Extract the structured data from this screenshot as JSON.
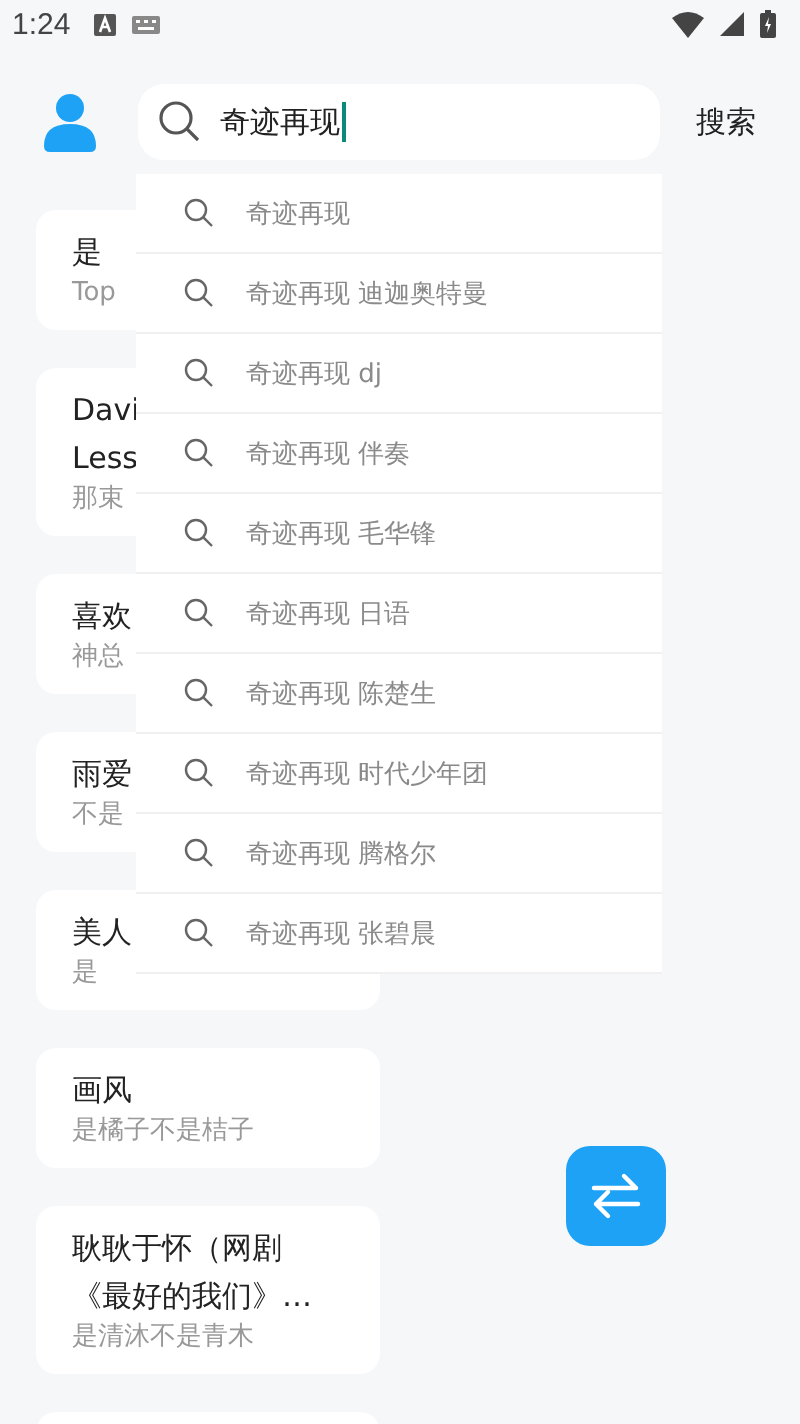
{
  "status_bar": {
    "time": "1:24"
  },
  "search": {
    "value": "奇迹再现",
    "button": "搜索"
  },
  "suggestions": [
    {
      "text": "奇迹再现"
    },
    {
      "text": "奇迹再现 迪迦奥特曼"
    },
    {
      "text": "奇迹再现 dj"
    },
    {
      "text": "奇迹再现 伴奏"
    },
    {
      "text": "奇迹再现 毛华锋"
    },
    {
      "text": "奇迹再现 日语"
    },
    {
      "text": "奇迹再现 陈楚生"
    },
    {
      "text": "奇迹再现 时代少年团"
    },
    {
      "text": "奇迹再现 腾格尔"
    },
    {
      "text": "奇迹再现 张碧晨"
    }
  ],
  "songs": [
    {
      "title": [
        "是"
      ],
      "artist": "Top"
    },
    {
      "title": [
        "Davi",
        "Less"
      ],
      "artist": "那束"
    },
    {
      "title": [
        "喜欢"
      ],
      "artist": "神总"
    },
    {
      "title": [
        "雨爱"
      ],
      "artist": "不是"
    },
    {
      "title": [
        "美人"
      ],
      "artist": "是"
    },
    {
      "title": [
        "画风"
      ],
      "artist": "是橘子不是桔子"
    },
    {
      "title": [
        "耿耿于怀（网剧",
        "《最好的我们》…"
      ],
      "artist": "是清沐不是青木"
    }
  ]
}
